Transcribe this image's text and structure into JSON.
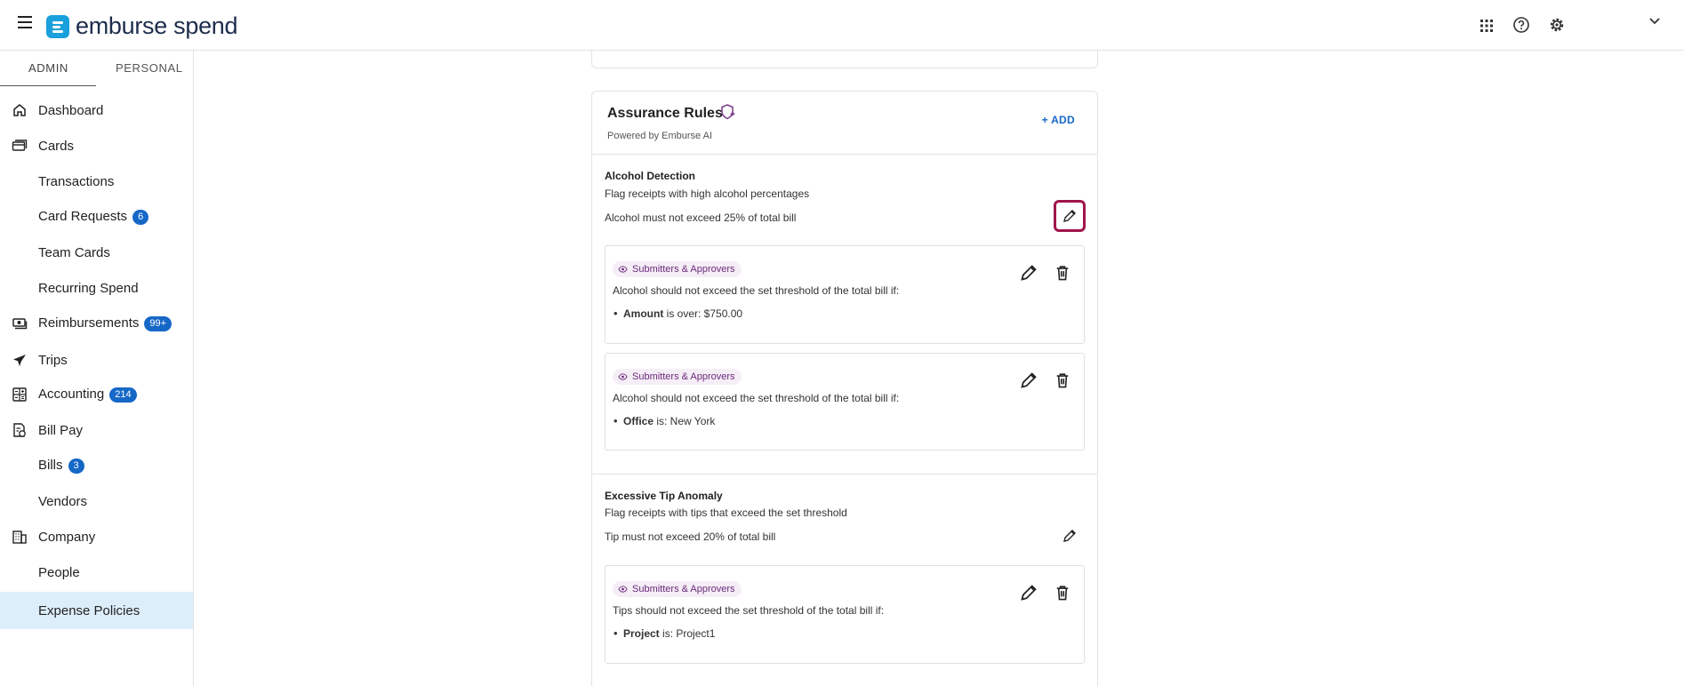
{
  "app": {
    "brand": "emburse spend"
  },
  "sidebar": {
    "tabs": [
      "ADMIN",
      "PERSONAL"
    ],
    "items": [
      {
        "label": "Dashboard",
        "icon": "home-icon"
      },
      {
        "label": "Cards",
        "icon": "cards-icon"
      },
      {
        "label": "Transactions"
      },
      {
        "label": "Card Requests",
        "badge": "6"
      },
      {
        "label": "Team Cards"
      },
      {
        "label": "Recurring Spend"
      },
      {
        "label": "Reimbursements",
        "badge": "99+",
        "icon": "cash-icon"
      },
      {
        "label": "Trips",
        "icon": "plane-icon"
      },
      {
        "label": "Accounting",
        "badge": "214",
        "icon": "accounting-icon"
      },
      {
        "label": "Bill Pay",
        "icon": "bill-icon"
      },
      {
        "label": "Bills",
        "badge": "3"
      },
      {
        "label": "Vendors"
      },
      {
        "label": "Company",
        "icon": "building-icon"
      },
      {
        "label": "People"
      },
      {
        "label": "Expense Policies"
      }
    ]
  },
  "assurance": {
    "title": "Assurance Rules",
    "powered_by": "Powered by Emburse AI",
    "add_label": "+ ADD",
    "rules": [
      {
        "title": "Alcohol Detection",
        "description": "Flag receipts with high alcohol percentages",
        "limit": "Alcohol must not exceed 25% of total bill",
        "conditions": [
          {
            "audience": "Submitters & Approvers",
            "text": "Alcohol should not exceed the set threshold of the total bill if:",
            "field": "Amount",
            "rest": " is over: $750.00"
          },
          {
            "audience": "Submitters & Approvers",
            "text": "Alcohol should not exceed the set threshold of the total bill if:",
            "field": "Office",
            "rest": " is: New York"
          }
        ]
      },
      {
        "title": "Excessive Tip Anomaly",
        "description": "Flag receipts with tips that exceed the set threshold",
        "limit": "Tip must not exceed 20% of total bill",
        "conditions": [
          {
            "audience": "Submitters & Approvers",
            "text": "Tips should not exceed the set threshold of the total bill if:",
            "field": "Project",
            "rest": " is: Project1"
          }
        ]
      }
    ]
  },
  "colors": {
    "accent": "#1668c7",
    "highlight": "#a0154c",
    "pill_bg": "#f6eef7",
    "active_nav": "#ddeefb"
  }
}
